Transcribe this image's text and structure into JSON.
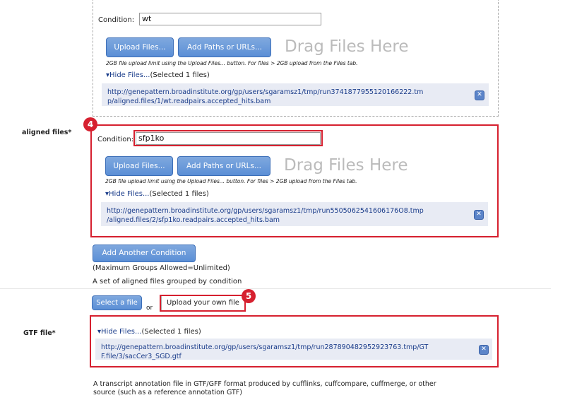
{
  "groups": [
    {
      "condition_label": "Condition:",
      "condition_value": "wt",
      "upload_button": "Upload Files...",
      "paths_button": "Add Paths or URLs...",
      "drag_text": "Drag Files Here",
      "hint": "2GB file upload limit using the Upload Files... button. For files > 2GB upload from the Files tab.",
      "hide_link": "▾Hide Files...",
      "selected_text": "(Selected 1 files)",
      "file_path_line1": "http://genepattern.broadinstitute.org/gp/users/sgaramsz1/tmp/run3741877955120166222.tm",
      "file_path_line2": "p/aligned.files/1/wt.readpairs.accepted_hits.bam"
    },
    {
      "condition_label": "Condition:",
      "condition_value": "sfp1ko",
      "upload_button": "Upload Files...",
      "paths_button": "Add Paths or URLs...",
      "drag_text": "Drag Files Here",
      "hint": "2GB file upload limit using the Upload Files... button. For files > 2GB upload from the Files tab.",
      "hide_link": "▾Hide Files...",
      "selected_text": "(Selected 1 files)",
      "file_path_line1": "http://genepattern.broadinstitute.org/gp/users/sgaramsz1/tmp/run5505062541606176O8.tmp",
      "file_path_line2": "/aligned.files/2/sfp1ko.readpairs.accepted_hits.bam"
    }
  ],
  "aligned_label": "aligned files*",
  "badges": {
    "b4": "4",
    "b5": "5"
  },
  "add_condition_button": "Add Another Condition",
  "max_groups": "(Maximum Groups Allowed=Unlimited)",
  "aligned_desc": "A set of aligned files grouped by condition",
  "gtf": {
    "label": "GTF file*",
    "select_button": "Select a file",
    "or_text": "or",
    "upload_own": "Upload your own file",
    "hide_link": "▾Hide Files...",
    "selected_text": "(Selected 1 files)",
    "file_path_line1": "http://genepattern.broadinstitute.org/gp/users/sgaramsz1/tmp/run287890482952923763.tmp/GT",
    "file_path_line2": "F.file/3/sacCer3_SGD.gtf",
    "desc_line1": "A transcript annotation file in GTF/GFF format produced by cufflinks, cuffcompare, cuffmerge, or other",
    "desc_line2": "source (such as a reference annotation GTF)"
  },
  "colors": {
    "accent_red": "#d6202f",
    "button_blue": "#5b8fd6",
    "link_blue": "#1a3c8a"
  }
}
